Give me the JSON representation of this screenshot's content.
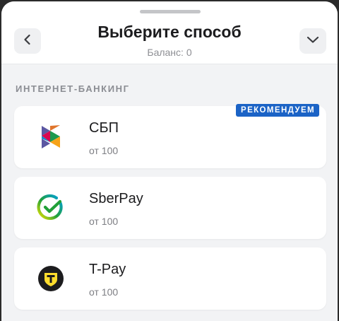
{
  "header": {
    "title": "Выберите способ",
    "subtitle": "Баланс: 0",
    "back_icon": "chevron-left-icon",
    "more_icon": "chevron-down-icon"
  },
  "section": {
    "label": "ИНТЕРНЕТ-БАНКИНГ"
  },
  "methods": [
    {
      "name": "СБП",
      "sub": "от 100",
      "badge": "РЕКОМЕНДУЕМ",
      "icon": "sbp-logo-icon"
    },
    {
      "name": "SberPay",
      "sub": "от 100",
      "icon": "sberpay-logo-icon"
    },
    {
      "name": "T-Pay",
      "sub": "от 100",
      "icon": "tpay-logo-icon"
    }
  ],
  "colors": {
    "badge": "#1b63c6",
    "sheet_background": "#f2f3f5",
    "card_background": "#ffffff",
    "tpay_yellow": "#ffdd2d"
  }
}
